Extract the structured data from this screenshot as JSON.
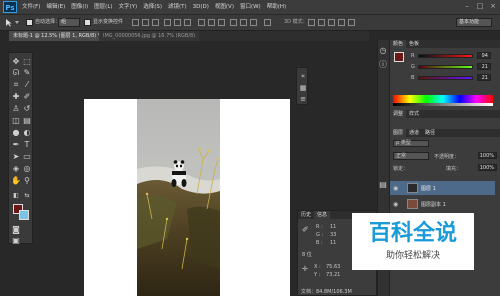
{
  "menubar": {
    "logo": "Ps",
    "items": [
      "文件(F)",
      "编辑(E)",
      "图像(I)",
      "图层(L)",
      "文字(Y)",
      "选择(S)",
      "滤镜(T)",
      "3D(D)",
      "视图(V)",
      "窗口(W)",
      "帮助(H)"
    ],
    "window_buttons": [
      "–",
      "□",
      "×"
    ]
  },
  "options": {
    "auto_select_label": "自动选择：",
    "auto_select_value": "组",
    "show_transform_label": "显示变换控件",
    "workspace": "基本功能"
  },
  "tabs": {
    "doc1": "未标题-1 @ 12.5% (图层 1, RGB/8) *",
    "doc2": "IMG_00000056.jpg @ 16.7% (RGB/8)"
  },
  "color_panel": {
    "tabs": [
      "颜色",
      "色板"
    ],
    "r_label": "R",
    "g_label": "G",
    "b_label": "B",
    "r_value": "94",
    "g_value": "21",
    "b_value": "21"
  },
  "adjust_panel": {
    "tabs": [
      "调整",
      "样式"
    ]
  },
  "layers_panel": {
    "tabs": [
      "图层",
      "通道",
      "路径"
    ],
    "filter_label": "ρ 类型",
    "blend_mode": "正常",
    "opacity_label": "不透明度：",
    "opacity_value": "100%",
    "lock_label": "锁定：",
    "fill_label": "填充：",
    "fill_value": "100%",
    "layers": [
      {
        "name": "图层 1",
        "selected": true
      },
      {
        "name": "图层副本 1",
        "selected": false
      }
    ]
  },
  "info_panel": {
    "tabs": [
      "历史",
      "信息"
    ],
    "r": "R :",
    "r_val": "11",
    "g": "G :",
    "g_val": "33",
    "b": "B :",
    "b_val": "11",
    "bit": "8 位",
    "x": "X :",
    "x_val": "75.63",
    "y": "Y :",
    "y_val": "73.21",
    "doc": "文档：84.8M/106.3M"
  },
  "watermark": {
    "title": "百科全说",
    "subtitle": "助你轻松解决"
  },
  "colors": {
    "foreground": "#6b1717",
    "background": "#7dc3e6",
    "accent": "#1a9bd7"
  }
}
